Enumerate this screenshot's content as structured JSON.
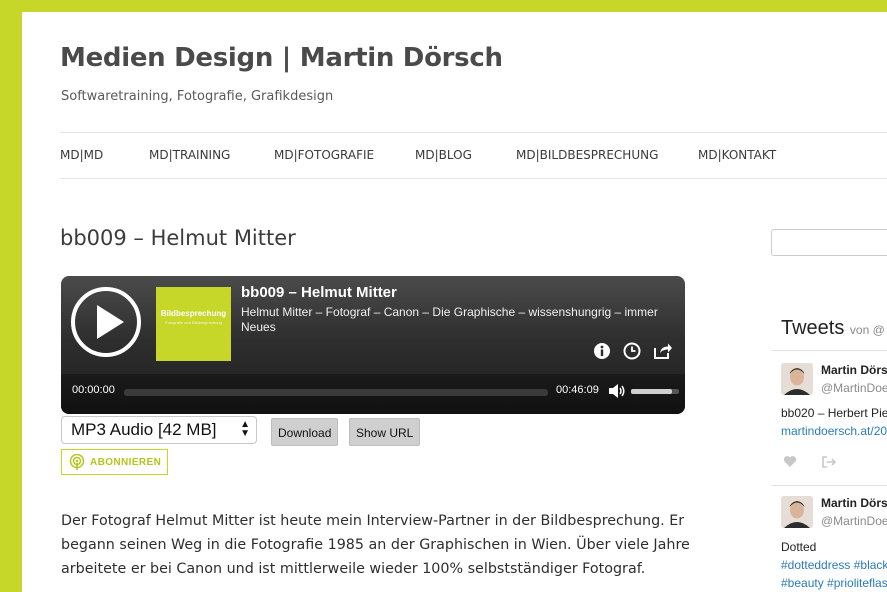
{
  "site": {
    "title": "Medien Design | Martin Dörsch",
    "tagline": "Softwaretraining, Fotografie, Grafikdesign"
  },
  "nav": [
    {
      "label": "MD|MD"
    },
    {
      "label": "MD|TRAINING"
    },
    {
      "label": "MD|FOTOGRAFIE"
    },
    {
      "label": "MD|BLOG"
    },
    {
      "label": "MD|BILDBESPRECHUNG"
    },
    {
      "label": "MD|KONTAKT"
    }
  ],
  "post": {
    "title": "bb009 – Helmut Mitter"
  },
  "player": {
    "cover_title": "Bildbesprechung",
    "cover_subtitle": "Fotografie und Bildbesprechung",
    "episode_title": "bb009 – Helmut Mitter",
    "episode_subtitle": "Helmut Mitter – Fotograf – Canon – Die Graphische – wissenshungrig – immer Neues",
    "current_time": "00:00:00",
    "duration": "00:46:09",
    "progress": 0,
    "volume": 0.85,
    "icons": [
      "play-icon",
      "info-icon",
      "chapters-clock-icon",
      "share-icon",
      "volume-icon"
    ]
  },
  "download": {
    "selected_format": "MP3 Audio [42 MB]",
    "download_label": "Download",
    "show_url_label": "Show URL",
    "subscribe_label": "ABONNIEREN"
  },
  "content": {
    "paragraph": "Der Fotograf Helmut Mitter ist heute mein Interview-Partner in der Bildbesprechung. Er begann seinen Weg in die Fotografie 1985 an der Graphischen in Wien. Über viele Jahre arbeitete er bei Canon und ist mittlerweile wieder 100% selbstständiger Fotograf."
  },
  "sidebar": {
    "tweets_title": "Tweets",
    "tweets_by": "von @",
    "tweets": [
      {
        "name": "Martin Dörs",
        "handle": "@MartinDoe",
        "text": "bb020 – Herbert Pie",
        "link": "martindoersch.at/20"
      },
      {
        "name": "Martin Dörs",
        "handle": "@MartinDoe",
        "text": "Dotted",
        "tags1": "#dotteddress #black",
        "tags2": "#beauty #prioliteflas"
      }
    ]
  },
  "colors": {
    "accent": "#c7d72a",
    "player_bg": "#2f2f2f",
    "link": "#2b7bb9"
  }
}
